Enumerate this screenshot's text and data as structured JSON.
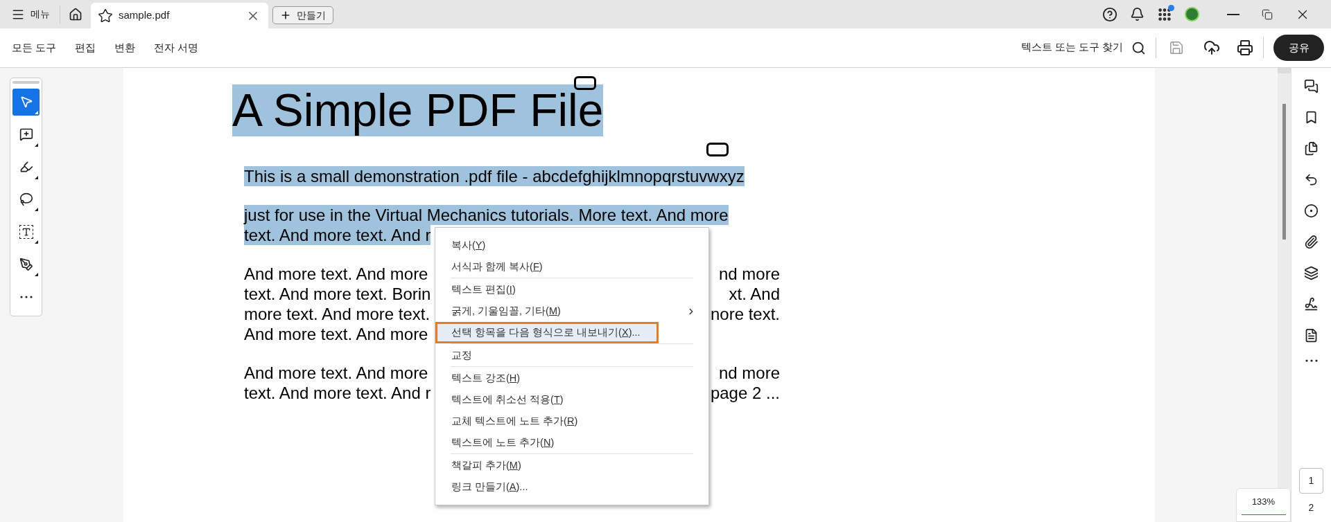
{
  "title_bar": {
    "menu_label": "메뉴",
    "tab": {
      "title": "sample.pdf"
    },
    "create_button": "만들기"
  },
  "toolbar": {
    "menus": [
      "모든 도구",
      "편집",
      "변환",
      "전자 서명"
    ],
    "search_label": "텍스트 또는 도구 찾기",
    "share_button": "공유"
  },
  "tools": [
    {
      "kind": "select",
      "selected": true
    },
    {
      "kind": "comment",
      "selected": false
    },
    {
      "kind": "highlight",
      "selected": false
    },
    {
      "kind": "draw",
      "selected": false
    },
    {
      "kind": "text_box",
      "selected": false
    },
    {
      "kind": "sign",
      "selected": false
    },
    {
      "kind": "more",
      "selected": false
    }
  ],
  "document": {
    "title": {
      "text": "A Simple PDF File",
      "highlighted": true
    },
    "paragraphs": [
      {
        "lines": [
          {
            "left": "This is a small demonstration .pdf file - abcdefghijklmnopqrstuvwxyz",
            "highlighted": true
          }
        ]
      },
      {
        "lines": [
          {
            "left": "just for use in the Virtual Mechanics tutorials. More text. And more",
            "highlighted": true
          },
          {
            "left": "text. And more text. And r",
            "highlighted": true
          }
        ]
      },
      {
        "lines": [
          {
            "left": "And more text. And more",
            "right": "nd more",
            "highlighted": false
          },
          {
            "left": "text. And more text. Borin",
            "right": "xt. And",
            "highlighted": false
          },
          {
            "left": "more text. And more text.",
            "right": "nore text.",
            "highlighted": false
          },
          {
            "left": "And more text. And more",
            "highlighted": false
          }
        ]
      },
      {
        "lines": [
          {
            "left": "And more text. And more",
            "right": "nd more",
            "highlighted": false
          },
          {
            "left": "text. And more text. And r",
            "right": "page 2 ...",
            "highlighted": false
          }
        ]
      }
    ]
  },
  "context_menu": {
    "groups": [
      [
        {
          "before": "복사(",
          "key": "Y",
          "after": ")",
          "submenu": false,
          "highlighted": false
        },
        {
          "before": "서식과 함께 복사(",
          "key": "F",
          "after": ")",
          "submenu": false,
          "highlighted": false
        }
      ],
      [
        {
          "before": "텍스트 편집(",
          "key": "I",
          "after": ")",
          "submenu": false,
          "highlighted": false
        },
        {
          "before": "굵게, 기울임꼴, 기타(",
          "key": "M",
          "after": ")",
          "submenu": true,
          "highlighted": false
        },
        {
          "before": "선택 항목을 다음 형식으로 내보내기(",
          "key": "X",
          "after": ")...",
          "submenu": false,
          "highlighted": true
        }
      ],
      [
        {
          "before": "교정",
          "submenu": false,
          "highlighted": false
        }
      ],
      [
        {
          "before": "텍스트 강조(",
          "key": "H",
          "after": ")",
          "submenu": false,
          "highlighted": false
        },
        {
          "before": "텍스트에 취소선 적용(",
          "key": "T",
          "after": ")",
          "submenu": false,
          "highlighted": false
        },
        {
          "before": "교체 텍스트에 노트 추가(",
          "key": "R",
          "after": ")",
          "submenu": false,
          "highlighted": false
        },
        {
          "before": "텍스트에 노트 추가(",
          "key": "N",
          "after": ")",
          "submenu": false,
          "highlighted": false
        }
      ],
      [
        {
          "before": "책갈피 추가(",
          "key": "M",
          "after": ")",
          "submenu": false,
          "highlighted": false
        },
        {
          "before": "링크 만들기(",
          "key": "A",
          "after": ")...",
          "submenu": false,
          "highlighted": false
        }
      ]
    ]
  },
  "zoom": "133%",
  "pages": [
    {
      "label": "1",
      "selected": true
    },
    {
      "label": "2",
      "selected": false
    }
  ]
}
